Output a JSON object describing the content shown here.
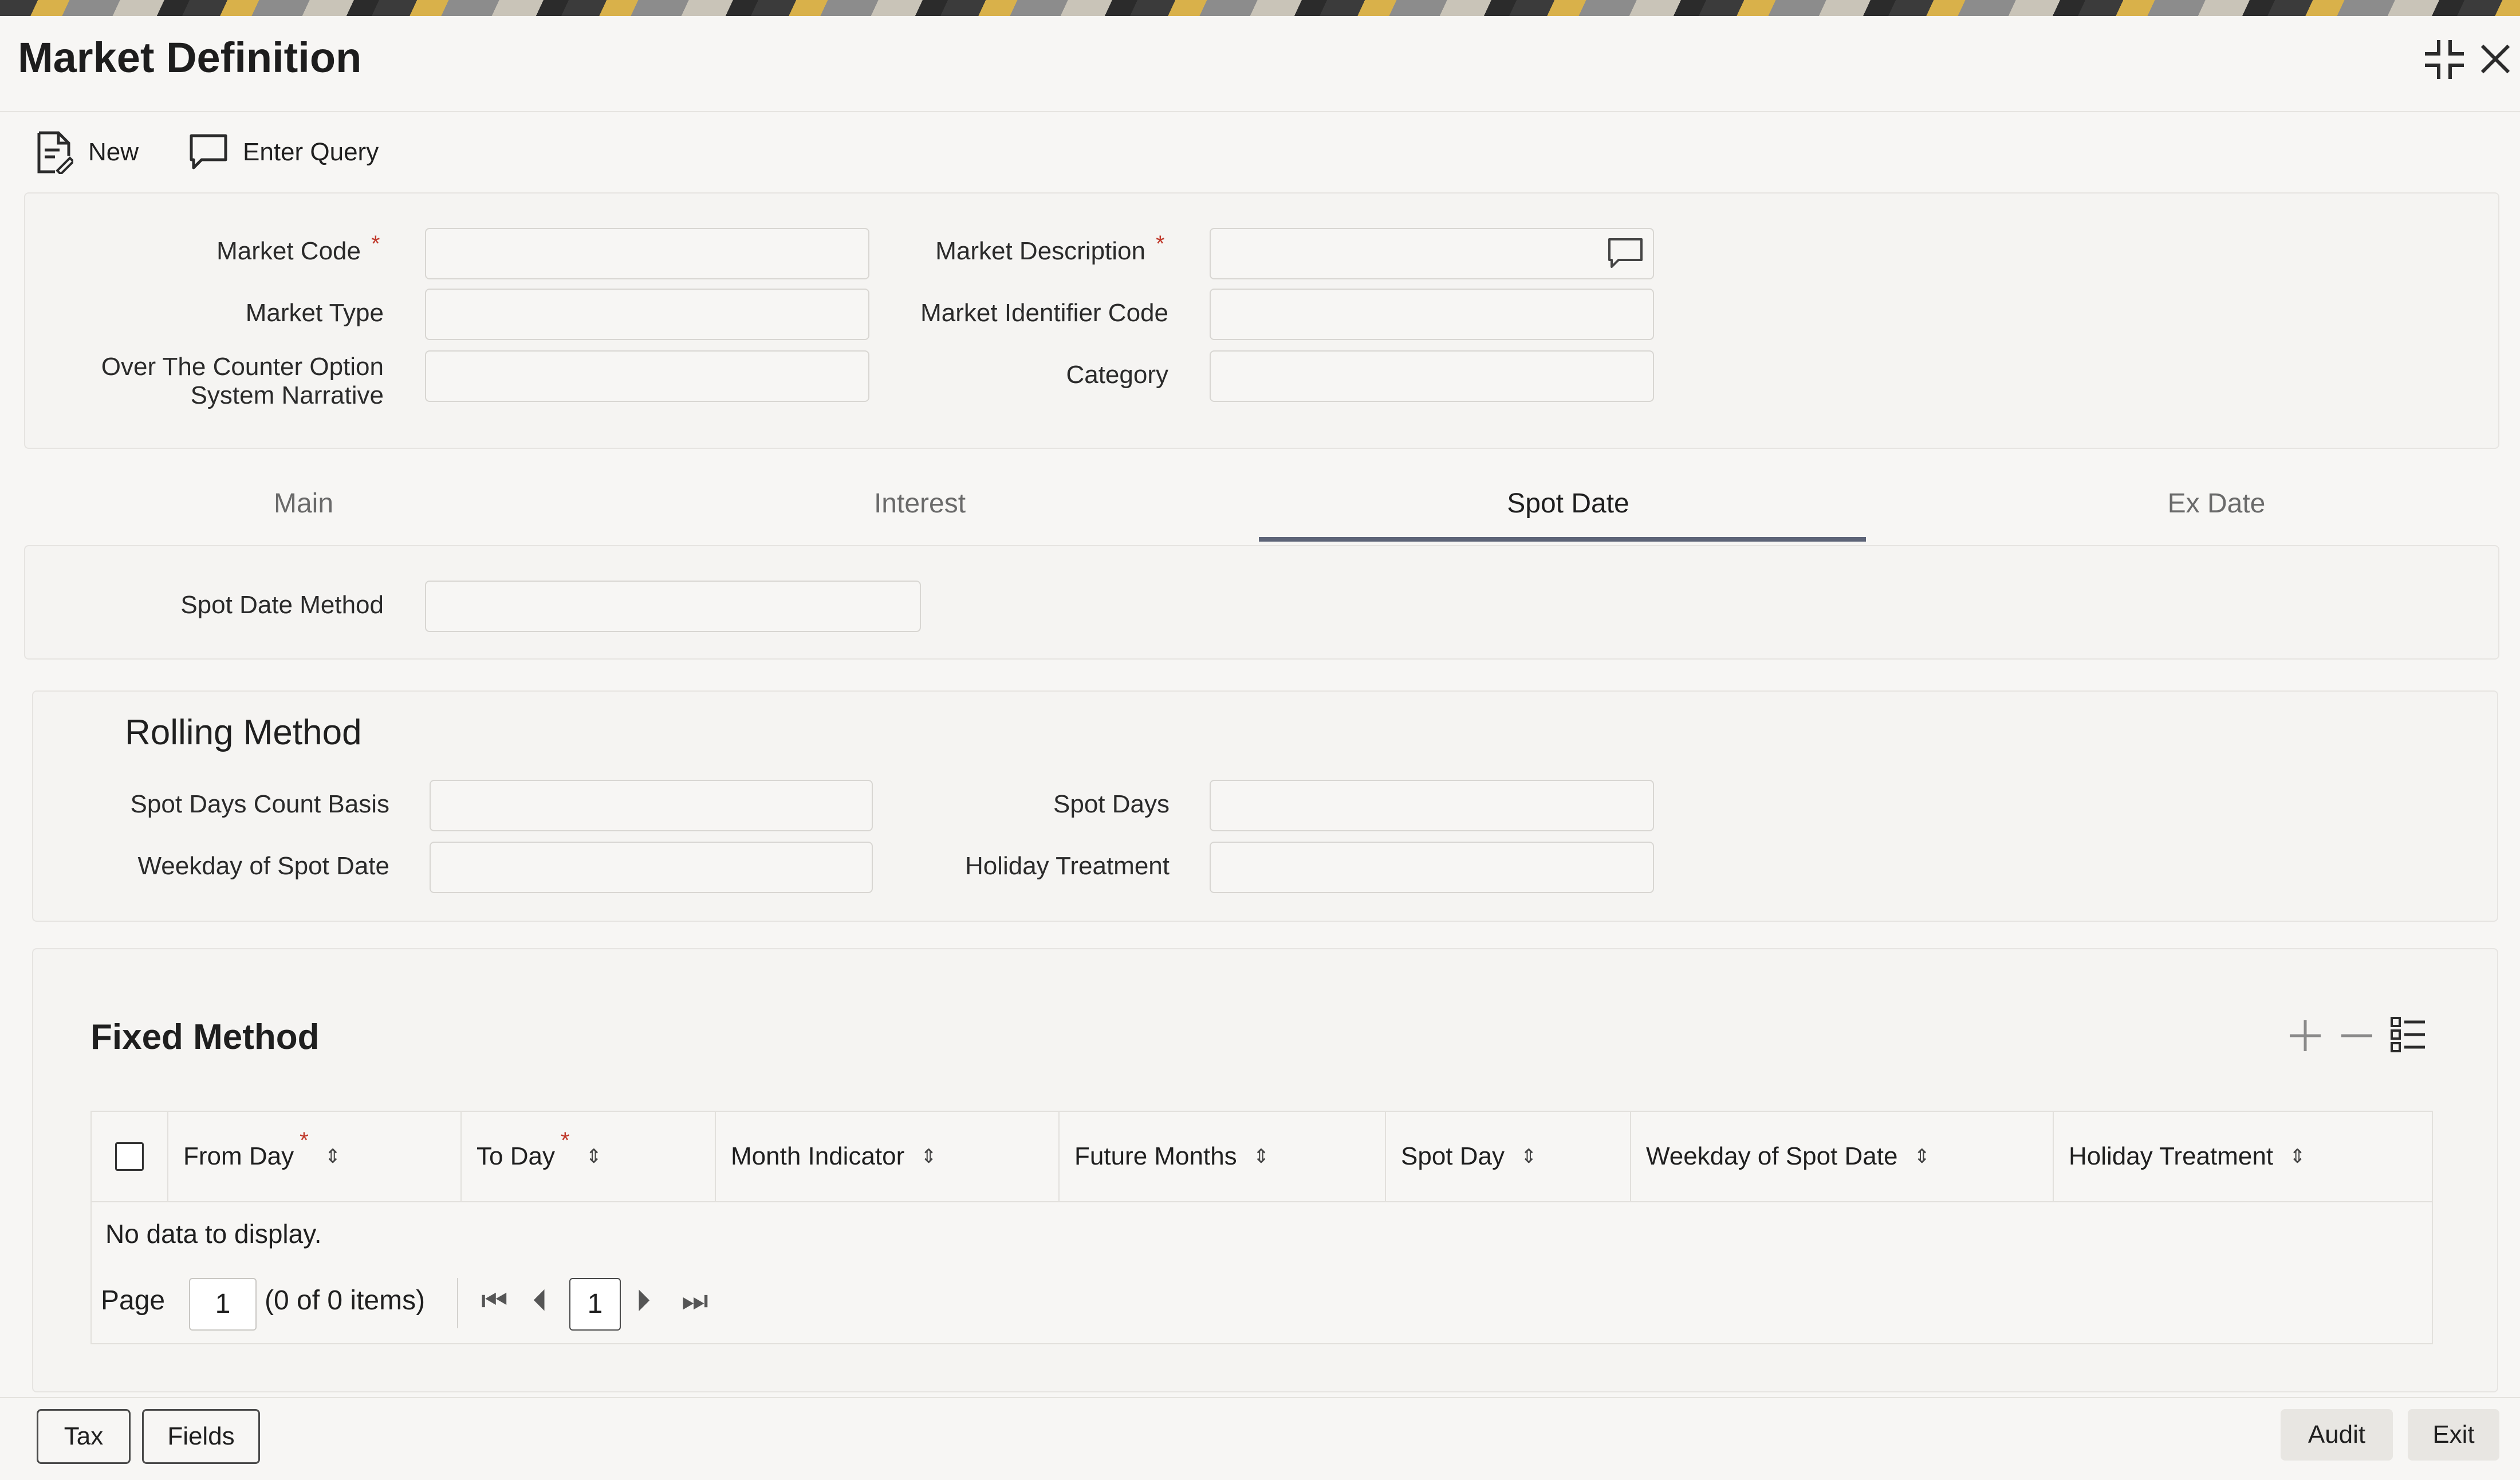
{
  "window": {
    "title": "Market Definition"
  },
  "toolbar": {
    "new_label": "New",
    "enter_query_label": "Enter Query"
  },
  "form": {
    "market_code_label": "Market Code",
    "market_type_label": "Market Type",
    "otc_label_line1": "Over The Counter Option",
    "otc_label_line2": "System Narrative",
    "market_description_label": "Market Description",
    "market_identifier_code_label": "Market Identifier Code",
    "category_label": "Category",
    "required_mark": "*"
  },
  "tabs": [
    {
      "label": "Main",
      "active": false
    },
    {
      "label": "Interest",
      "active": false
    },
    {
      "label": "Spot Date",
      "active": true
    },
    {
      "label": "Ex Date",
      "active": false
    }
  ],
  "spot_date": {
    "method_label": "Spot Date Method"
  },
  "rolling": {
    "title": "Rolling Method",
    "spot_days_count_basis_label": "Spot Days Count Basis",
    "weekday_of_spot_date_label": "Weekday of Spot Date",
    "spot_days_label": "Spot Days",
    "holiday_treatment_label": "Holiday Treatment"
  },
  "fixed": {
    "title": "Fixed Method",
    "columns": [
      {
        "label": "From Day",
        "required": true
      },
      {
        "label": "To Day",
        "required": true
      },
      {
        "label": "Month Indicator",
        "required": false
      },
      {
        "label": "Future Months",
        "required": false
      },
      {
        "label": "Spot Day",
        "required": false
      },
      {
        "label": "Weekday of Spot Date",
        "required": false
      },
      {
        "label": "Holiday Treatment",
        "required": false
      }
    ],
    "empty_text": "No data to display.",
    "pager": {
      "page_label": "Page",
      "page_value": "1",
      "items_text": "(0 of 0 items)",
      "current_page": "1"
    }
  },
  "footer": {
    "tax_label": "Tax",
    "fields_label": "Fields",
    "audit_label": "Audit",
    "exit_label": "Exit"
  },
  "colors": {
    "accent": "#5d6477",
    "required": "#c0392b"
  }
}
